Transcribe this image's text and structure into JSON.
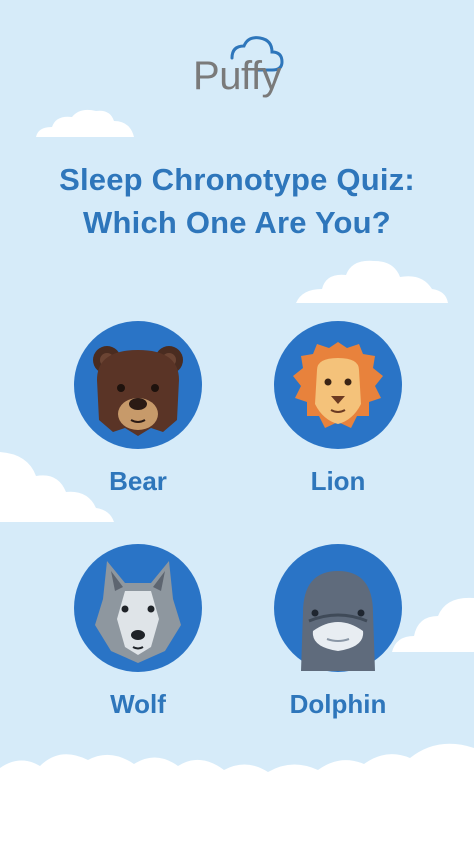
{
  "brand": {
    "name": "Puffy"
  },
  "title": {
    "line1": "Sleep Chronotype Quiz:",
    "line2": "Which One Are You?"
  },
  "chronotypes": [
    {
      "label": "Bear",
      "icon": "bear-icon"
    },
    {
      "label": "Lion",
      "icon": "lion-icon"
    },
    {
      "label": "Wolf",
      "icon": "wolf-icon"
    },
    {
      "label": "Dolphin",
      "icon": "dolphin-icon"
    }
  ],
  "colors": {
    "background": "#d6ebf9",
    "accent": "#2e76bb",
    "circle": "#2a74c6"
  }
}
